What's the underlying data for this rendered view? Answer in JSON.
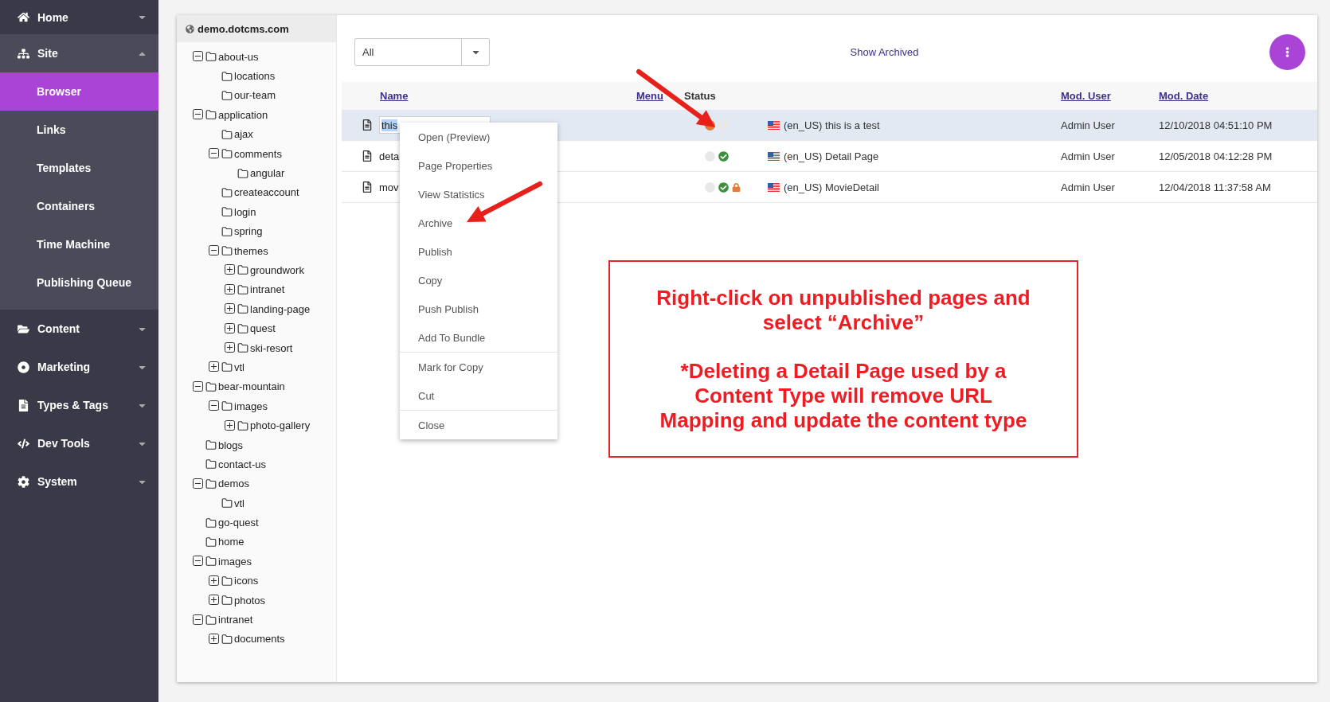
{
  "sidebar": {
    "groups": [
      {
        "label": "Home",
        "expanded": false
      },
      {
        "label": "Site",
        "expanded": true,
        "items": [
          {
            "label": "Browser",
            "selected": true
          },
          {
            "label": "Links",
            "selected": false
          },
          {
            "label": "Templates",
            "selected": false
          },
          {
            "label": "Containers",
            "selected": false
          },
          {
            "label": "Time Machine",
            "selected": false
          },
          {
            "label": "Publishing Queue",
            "selected": false
          }
        ]
      },
      {
        "label": "Content",
        "expanded": false
      },
      {
        "label": "Marketing",
        "expanded": false
      },
      {
        "label": "Types & Tags",
        "expanded": false
      },
      {
        "label": "Dev Tools",
        "expanded": false
      },
      {
        "label": "System",
        "expanded": false
      }
    ]
  },
  "site_tree": {
    "host": "demo.dotcms.com",
    "folders": [
      {
        "name": "about-us",
        "kind": "branch",
        "expanded": true,
        "children": [
          {
            "name": "locations",
            "kind": "leaf"
          },
          {
            "name": "our-team",
            "kind": "leaf"
          }
        ]
      },
      {
        "name": "application",
        "kind": "branch",
        "expanded": true,
        "children": [
          {
            "name": "ajax",
            "kind": "leaf"
          },
          {
            "name": "comments",
            "kind": "branch",
            "expanded": true,
            "children": [
              {
                "name": "angular",
                "kind": "leaf"
              }
            ]
          },
          {
            "name": "createaccount",
            "kind": "leaf"
          },
          {
            "name": "login",
            "kind": "leaf"
          },
          {
            "name": "spring",
            "kind": "leaf"
          },
          {
            "name": "themes",
            "kind": "branch",
            "expanded": true,
            "children": [
              {
                "name": "groundwork",
                "kind": "branch",
                "expanded": false
              },
              {
                "name": "intranet",
                "kind": "branch",
                "expanded": false
              },
              {
                "name": "landing-page",
                "kind": "branch",
                "expanded": false
              },
              {
                "name": "quest",
                "kind": "branch",
                "expanded": false
              },
              {
                "name": "ski-resort",
                "kind": "branch",
                "expanded": false
              }
            ]
          },
          {
            "name": "vtl",
            "kind": "branch",
            "expanded": false
          }
        ]
      },
      {
        "name": "bear-mountain",
        "kind": "branch",
        "expanded": true,
        "children": [
          {
            "name": "images",
            "kind": "branch",
            "expanded": true,
            "children": [
              {
                "name": "photo-gallery",
                "kind": "branch",
                "expanded": false
              }
            ]
          }
        ]
      },
      {
        "name": "blogs",
        "kind": "leaf"
      },
      {
        "name": "contact-us",
        "kind": "leaf"
      },
      {
        "name": "demos",
        "kind": "branch",
        "expanded": true,
        "children": [
          {
            "name": "vtl",
            "kind": "leaf"
          }
        ]
      },
      {
        "name": "go-quest",
        "kind": "leaf"
      },
      {
        "name": "home",
        "kind": "leaf"
      },
      {
        "name": "images",
        "kind": "branch",
        "expanded": true,
        "children": [
          {
            "name": "icons",
            "kind": "branch",
            "expanded": false
          },
          {
            "name": "photos",
            "kind": "branch",
            "expanded": false
          }
        ]
      },
      {
        "name": "intranet",
        "kind": "branch",
        "expanded": true,
        "children": [
          {
            "name": "documents",
            "kind": "branch",
            "expanded": false
          }
        ]
      }
    ]
  },
  "toolbar": {
    "filter": {
      "value": "All"
    },
    "show_archived": "Show Archived"
  },
  "table": {
    "columns": [
      {
        "label": "Name",
        "sortable": true
      },
      {
        "label": "Menu",
        "sortable": true
      },
      {
        "label": "Status",
        "sortable": false
      },
      {
        "label": "Mod. User",
        "sortable": true
      },
      {
        "label": "Mod. Date",
        "sortable": true
      }
    ],
    "rows": [
      {
        "name": "this",
        "editing": true,
        "selected": true,
        "status": [
          {
            "kind": "dot",
            "color": "#e27b3a"
          },
          {
            "kind": "dot",
            "color": "#e8e8e8"
          }
        ],
        "title": "(en_US) this is a test",
        "user": "Admin User",
        "date": "12/10/2018 04:51:10 PM"
      },
      {
        "name": "deta",
        "editing": false,
        "selected": false,
        "status": [
          {
            "kind": "dot",
            "color": "#e8e8e8"
          },
          {
            "kind": "check"
          }
        ],
        "title": "(en_US) Detail Page",
        "user": "Admin User",
        "date": "12/05/2018 04:12:28 PM"
      },
      {
        "name": "mov",
        "editing": false,
        "selected": false,
        "status": [
          {
            "kind": "dot",
            "color": "#e8e8e8"
          },
          {
            "kind": "check"
          },
          {
            "kind": "lock"
          }
        ],
        "title": "(en_US) MovieDetail",
        "user": "Admin User",
        "date": "12/04/2018 11:37:58 AM"
      }
    ]
  },
  "context_menu": {
    "groups": [
      [
        "Open (Preview)",
        "Page Properties",
        "View Statistics",
        "Archive",
        "Publish",
        "Copy",
        "Push Publish",
        "Add To Bundle"
      ],
      [
        "Mark for Copy",
        "Cut"
      ],
      [
        "Close"
      ]
    ]
  },
  "annotation": {
    "paragraphs": [
      "Right-click on unpublished pages and select “Archive”",
      "*Deleting a Detail Page used by a Content Type will remove URL Mapping and update the content type"
    ]
  }
}
